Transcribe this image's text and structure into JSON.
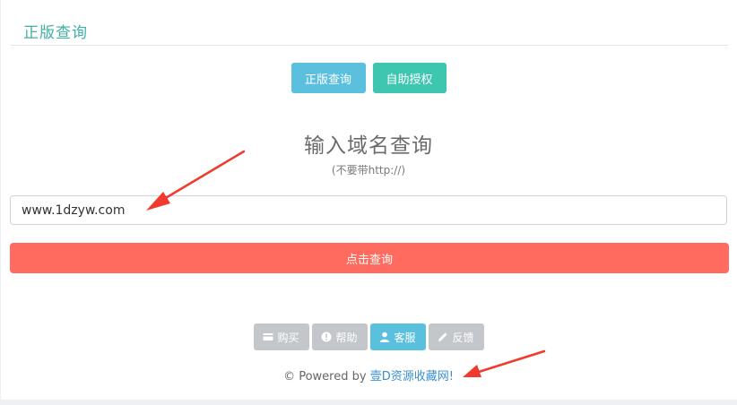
{
  "panel": {
    "title": "正版查询"
  },
  "tabs": {
    "query_label": "正版查询",
    "auth_label": "自助授权"
  },
  "main": {
    "heading": "输入域名查询",
    "subheading": "(不要带http://)",
    "input_value": "www.1dzyw.com",
    "submit_label": "点击查询"
  },
  "footer": {
    "buy_label": "购买",
    "help_label": "帮助",
    "service_label": "客服",
    "feedback_label": "反馈",
    "powered_prefix": "© Powered by",
    "powered_brand": "壹D资源收藏网!"
  },
  "icons": {
    "buy": "card-icon",
    "help": "exclamation-circle-icon",
    "service": "user-icon",
    "feedback": "pencil-icon"
  },
  "colors": {
    "title_teal": "#3fb0a4",
    "query_blue": "#5bc0de",
    "auth_teal": "#3fc6b0",
    "submit_red": "#ff6b5e",
    "footer_gray": "#c3c7cc",
    "arrow_red": "#f03a2e",
    "brand_link": "#3a8fd1"
  }
}
